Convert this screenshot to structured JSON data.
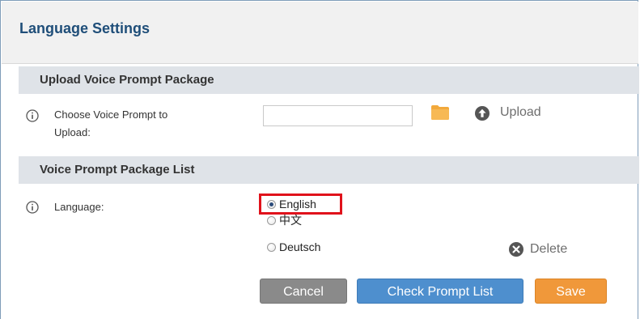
{
  "header": {
    "title": "Language Settings"
  },
  "upload_section": {
    "heading": "Upload Voice Prompt Package",
    "label_line1": "Choose Voice Prompt to",
    "label_line2": "Upload:",
    "file_input_value": "",
    "upload_label": "Upload"
  },
  "list_section": {
    "heading": "Voice Prompt Package List",
    "language_label": "Language:",
    "options": [
      {
        "label": "English",
        "checked": true
      },
      {
        "label": "中文",
        "checked": false
      },
      {
        "label": "Deutsch",
        "checked": false
      }
    ],
    "delete_label": "Delete"
  },
  "buttons": {
    "cancel": "Cancel",
    "check": "Check Prompt List",
    "save": "Save"
  },
  "colors": {
    "title": "#1f4e79",
    "section_bg": "#dfe3e8",
    "highlight": "#e0121b",
    "cancel_bg": "#8a8a8a",
    "check_bg": "#4e8fce",
    "save_bg": "#f0983a"
  }
}
